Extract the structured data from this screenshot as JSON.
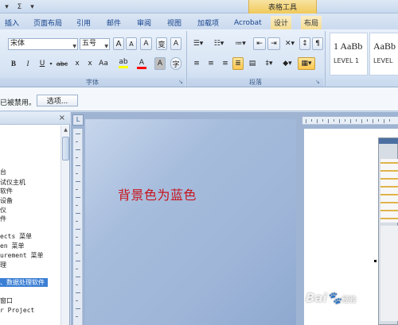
{
  "titlebar": {
    "qat_icons": [
      "dropdown-arrow",
      "sigma",
      "customize-arrow"
    ],
    "contextual_title": "表格工具"
  },
  "tabs": [
    {
      "label": "插入"
    },
    {
      "label": "页面布局"
    },
    {
      "label": "引用"
    },
    {
      "label": "邮件"
    },
    {
      "label": "审阅"
    },
    {
      "label": "视图"
    },
    {
      "label": "加载项"
    },
    {
      "label": "Acrobat"
    },
    {
      "label": "设计"
    },
    {
      "label": "布局"
    }
  ],
  "ribbon": {
    "font": {
      "name": "宋体",
      "size": "五号",
      "grow_label": "A",
      "shrink_label": "A",
      "clear_label": "A",
      "phonetic_label": "变",
      "border_label": "A",
      "bold": "B",
      "italic": "I",
      "underline": "U",
      "strike": "abc",
      "subscript": "x",
      "superscript": "x",
      "change_case": "Aa",
      "font_color_label": "A",
      "shading_label": "A",
      "encircle_label": "字",
      "group_label": "字体"
    },
    "paragraph": {
      "group_label": "段落"
    },
    "styles": [
      {
        "sample": "1 AaBb",
        "name": "LEVEL 1"
      },
      {
        "sample": "AaBb",
        "name": "LEVEL"
      }
    ],
    "colors": {
      "highlight": "#ffff00",
      "font_color": "#ff0000"
    }
  },
  "message_bar": {
    "text": "已被禁用。",
    "options_button": "选项..."
  },
  "nav_pane": {
    "close_label": "×",
    "items": [
      {
        "label": "台"
      },
      {
        "label": "试仪主机"
      },
      {
        "label": "软件"
      },
      {
        "label": "设备"
      },
      {
        "label": "仪"
      },
      {
        "label": "件"
      },
      {
        "label": "ects 菜单"
      },
      {
        "label": "en 菜单"
      },
      {
        "label": "urement 菜单"
      },
      {
        "label": "理"
      },
      {
        "label": "、数据处理软件"
      },
      {
        "label": "窗口"
      },
      {
        "label": "r Project"
      }
    ]
  },
  "document": {
    "body_text": "背景色为蓝色",
    "text_color": "#c8141c",
    "page_background": "#a6bcdc"
  },
  "watermark": {
    "brand": "Bai",
    "suffix": "经验"
  }
}
